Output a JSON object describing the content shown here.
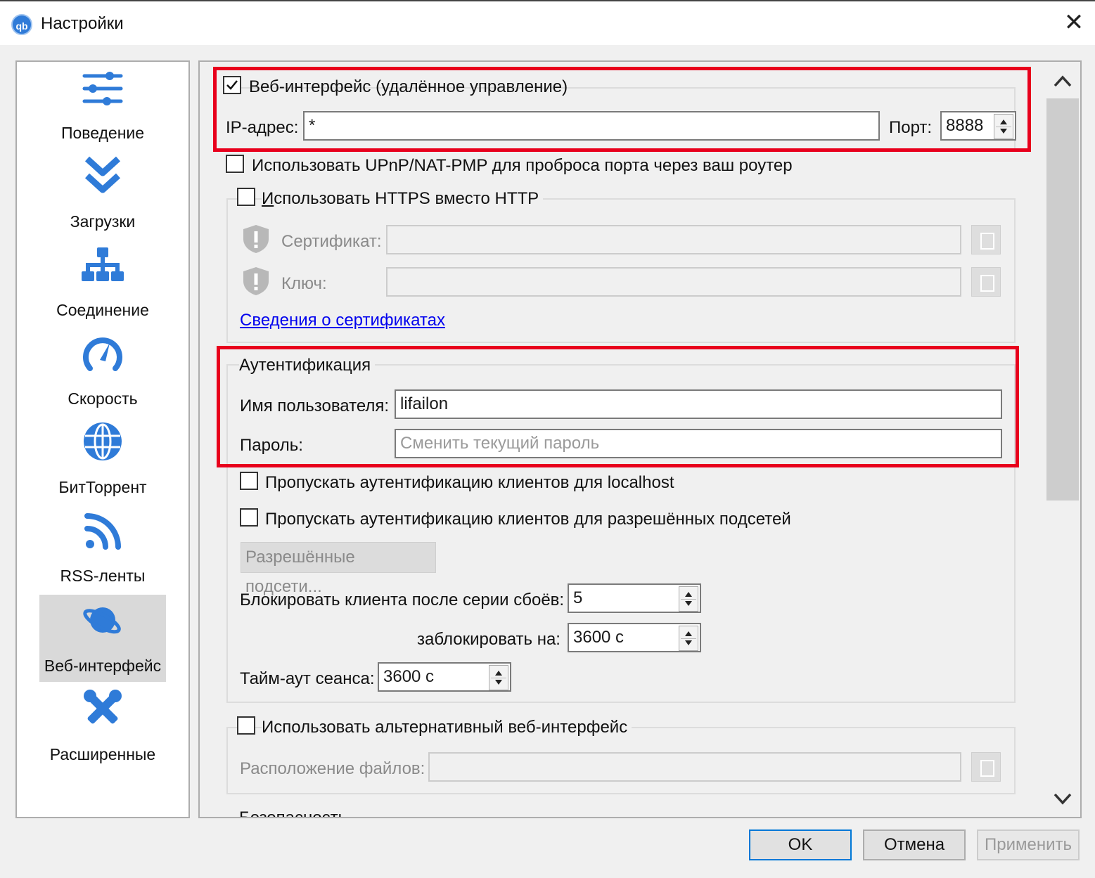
{
  "window": {
    "title": "Настройки",
    "app_icon_text": "qb",
    "close_glyph": "✕"
  },
  "sidebar": {
    "items": [
      {
        "label": "Поведение",
        "icon": "sliders-icon"
      },
      {
        "label": "Загрузки",
        "icon": "double-chevron-down-icon"
      },
      {
        "label": "Соединение",
        "icon": "network-icon"
      },
      {
        "label": "Скорость",
        "icon": "speedometer-icon"
      },
      {
        "label": "БитТоррент",
        "icon": "globe-icon"
      },
      {
        "label": "RSS-ленты",
        "icon": "rss-icon"
      },
      {
        "label": "Веб-интерфейс",
        "icon": "planet-icon",
        "active": true
      },
      {
        "label": "Расширенные",
        "icon": "tools-icon"
      }
    ]
  },
  "webui": {
    "enable_label": "Веб-интерфейс (удалённое управление)",
    "enable_checked": true,
    "ip_label": "IP-адрес:",
    "ip_value": "*",
    "port_label": "Порт:",
    "port_value": "8888",
    "upnp_label": "Использовать UPnP/NAT-PMP для проброса порта через ваш роутер"
  },
  "https": {
    "enable_label_first": "И",
    "enable_label_rest": "спользовать HTTPS вместо HTTP",
    "cert_label": "Сертификат:",
    "key_label": "Ключ:",
    "cert_info_link": "Сведения о сертификатах"
  },
  "auth": {
    "group_title": "Аутентификация",
    "username_label": "Имя пользователя:",
    "username_value": "lifailon",
    "password_label": "Пароль:",
    "password_placeholder": "Сменить текущий пароль",
    "bypass_localhost_label": "Пропускать аутентификацию клиентов для localhost",
    "bypass_subnets_label": "Пропускать аутентификацию клиентов для разрешённых подсетей",
    "subnets_button": "Разрешённые подсети...",
    "ban_after_label": "Блокировать клиента после серии сбоёв:",
    "ban_after_value": "5",
    "ban_for_label": "заблокировать на:",
    "ban_for_value": "3600 с",
    "session_timeout_label": "Тайм-аут сеанса:",
    "session_timeout_value": "3600 с"
  },
  "alt_webui": {
    "enable_label": "Использовать альтернативный веб-интерфейс",
    "files_location_label": "Расположение файлов:"
  },
  "security": {
    "group_title": "Безопасность"
  },
  "buttons": {
    "ok": "OK",
    "cancel": "Отмена",
    "apply": "Применить"
  },
  "colors": {
    "accent_blue": "#2f7bd8",
    "highlight_red": "#e8001c",
    "link": "#0000ee"
  }
}
